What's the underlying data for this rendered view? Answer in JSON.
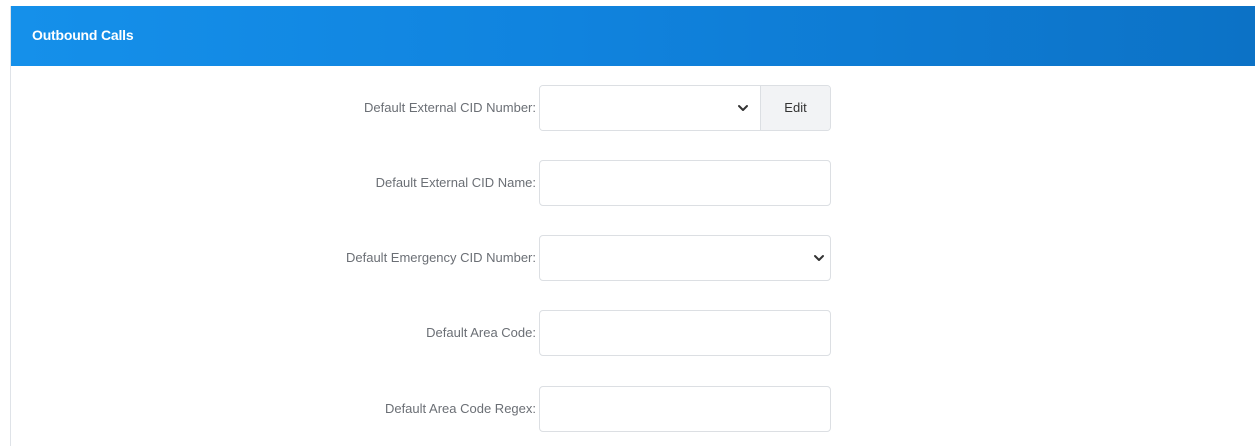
{
  "panel": {
    "title": "Outbound Calls"
  },
  "fields": [
    {
      "label": "Default External CID Number:",
      "type": "select-with-button",
      "value": "",
      "button_label": "Edit"
    },
    {
      "label": "Default External CID Name:",
      "type": "text",
      "value": ""
    },
    {
      "label": "Default Emergency CID Number:",
      "type": "select",
      "value": ""
    },
    {
      "label": "Default Area Code:",
      "type": "text",
      "value": ""
    },
    {
      "label": "Default Area Code Regex:",
      "type": "text",
      "value": ""
    }
  ],
  "icons": {
    "dropdown": "chevron-down-icon"
  },
  "colors": {
    "header_start": "#1590ea",
    "header_end": "#0c72c6",
    "label_text": "#6b6f75",
    "border": "#dcdfe3",
    "button_bg": "#f2f3f5"
  }
}
